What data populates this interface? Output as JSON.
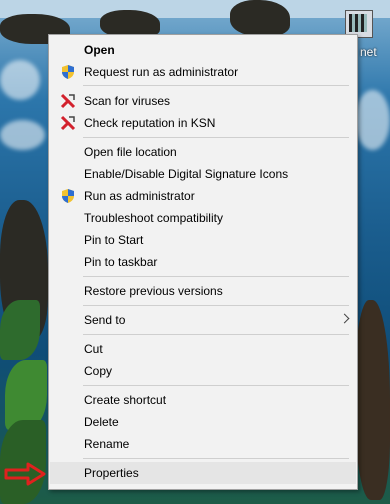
{
  "desktop": {
    "icon_label": "net"
  },
  "context_menu": {
    "items": [
      {
        "label": "Open"
      },
      {
        "label": "Request run as administrator"
      },
      {
        "label": "Scan for viruses"
      },
      {
        "label": "Check reputation in KSN"
      },
      {
        "label": "Open file location"
      },
      {
        "label": "Enable/Disable Digital Signature Icons"
      },
      {
        "label": "Run as administrator"
      },
      {
        "label": "Troubleshoot compatibility"
      },
      {
        "label": "Pin to Start"
      },
      {
        "label": "Pin to taskbar"
      },
      {
        "label": "Restore previous versions"
      },
      {
        "label": "Send to"
      },
      {
        "label": "Cut"
      },
      {
        "label": "Copy"
      },
      {
        "label": "Create shortcut"
      },
      {
        "label": "Delete"
      },
      {
        "label": "Rename"
      },
      {
        "label": "Properties"
      }
    ]
  },
  "colors": {
    "shield_blue": "#2f6fd1",
    "shield_yellow": "#f2c230",
    "kaspersky_red": "#d3212d",
    "pointer_red": "#e0211e"
  }
}
